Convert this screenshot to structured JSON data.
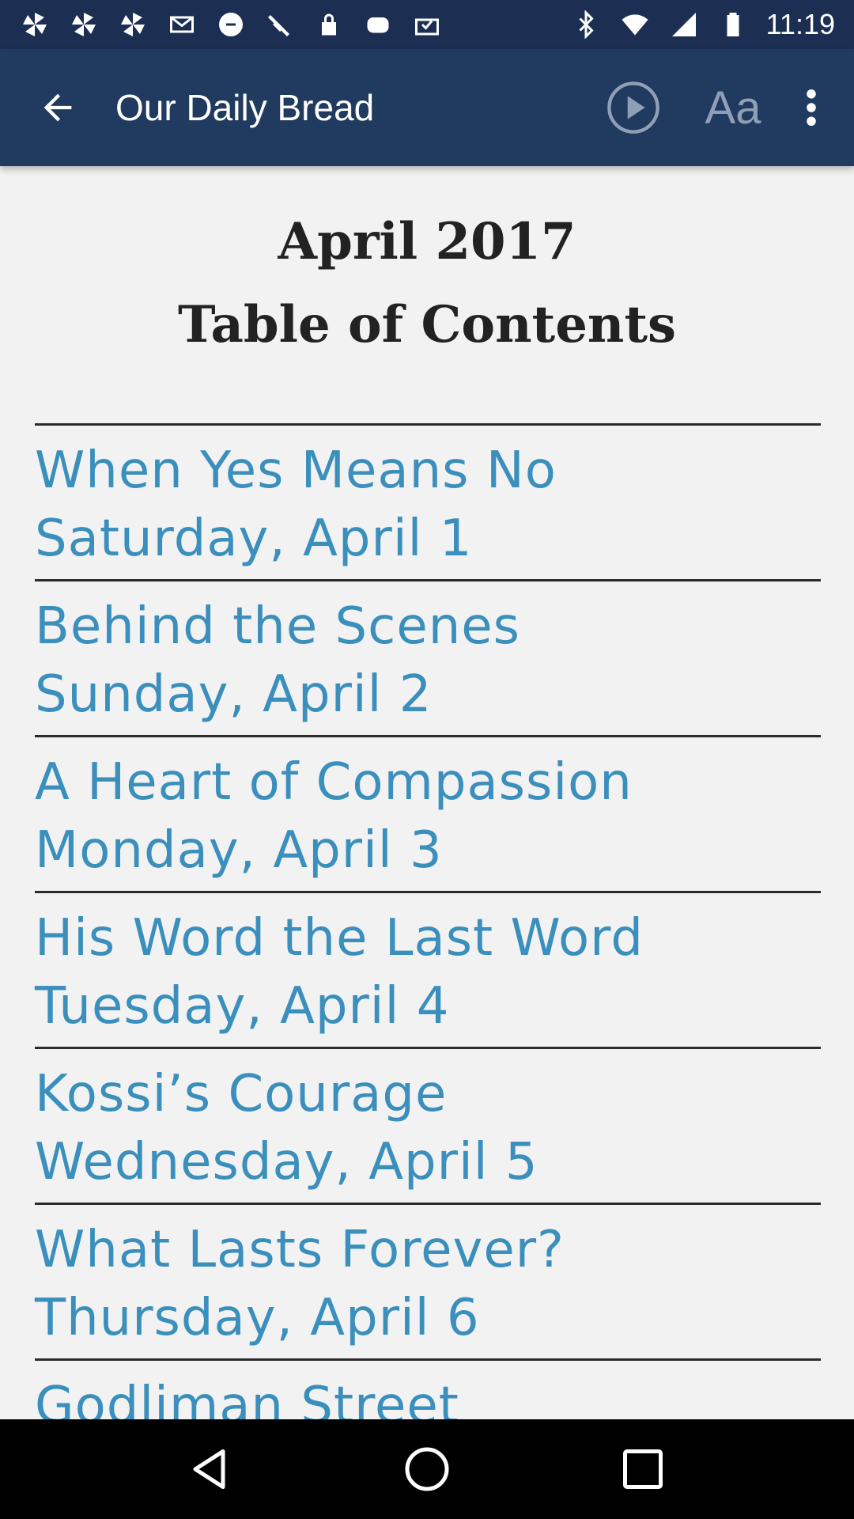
{
  "status_bar": {
    "time": "11:19",
    "left_icons": [
      "pinwheel-icon",
      "pinwheel-icon",
      "pinwheel-icon",
      "email-icon",
      "no-disturb-icon",
      "satellite-icon",
      "lock-icon",
      "cloud-icon",
      "inbox-check-icon"
    ],
    "right_icons": [
      "bluetooth-icon",
      "wifi-icon",
      "signal-icon",
      "battery-icon"
    ]
  },
  "app_bar": {
    "title": "Our Daily Bread",
    "font_button_label": "Aa",
    "background": "#213a5f",
    "status_background": "#1c2f52"
  },
  "content": {
    "month": "April 2017",
    "heading": "Table of Contents",
    "link_color": "#3a8fbd",
    "entries": [
      {
        "title": "When Yes Means No",
        "date": "Saturday, April 1"
      },
      {
        "title": "Behind the Scenes",
        "date": "Sunday, April 2"
      },
      {
        "title": "A Heart of Compassion",
        "date": "Monday, April 3"
      },
      {
        "title": "His Word the Last Word",
        "date": "Tuesday, April 4"
      },
      {
        "title": "Kossi’s Courage",
        "date": "Wednesday, April 5"
      },
      {
        "title": "What Lasts Forever?",
        "date": "Thursday, April 6"
      },
      {
        "title": "Godliman Street",
        "date": ""
      }
    ]
  }
}
